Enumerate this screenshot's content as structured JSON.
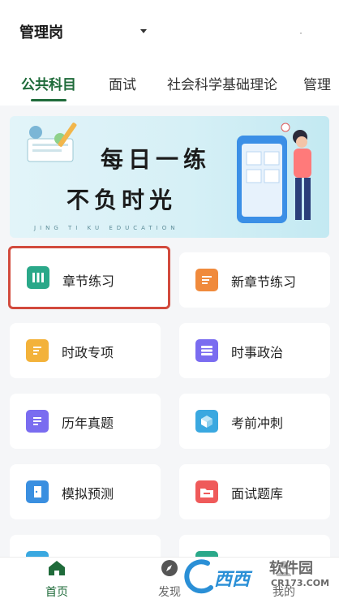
{
  "header": {
    "selector_label": "管理岗"
  },
  "tabs": [
    {
      "label": "公共科目",
      "active": true
    },
    {
      "label": "面试",
      "active": false
    },
    {
      "label": "社会科学基础理论",
      "active": false
    },
    {
      "label": "管理",
      "active": false
    }
  ],
  "banner": {
    "line1": "每日一练",
    "line2": "不负时光",
    "sub": "JING TI KU EDUCATION"
  },
  "grid": [
    {
      "label": "章节练习",
      "icon": "chapter-practice-icon",
      "color": "#2aa889"
    },
    {
      "label": "新章节练习",
      "icon": "new-chapter-icon",
      "color": "#f08a3c"
    },
    {
      "label": "时政专项",
      "icon": "current-affairs-icon",
      "color": "#f3b23a"
    },
    {
      "label": "时事政治",
      "icon": "list-icon",
      "color": "#7a6cf0"
    },
    {
      "label": "历年真题",
      "icon": "past-exams-icon",
      "color": "#7a6cf0"
    },
    {
      "label": "考前冲刺",
      "icon": "cube-icon",
      "color": "#3aa8e0"
    },
    {
      "label": "模拟预测",
      "icon": "door-icon",
      "color": "#3a8fe0"
    },
    {
      "label": "面试题库",
      "icon": "folder-icon",
      "color": "#ef5a5a"
    }
  ],
  "bottom_nav": [
    {
      "label": "首页",
      "icon": "home-icon",
      "active": true
    },
    {
      "label": "发现",
      "icon": "compass-icon",
      "active": false
    },
    {
      "label": "我的",
      "icon": "user-icon",
      "active": false
    }
  ],
  "watermark": {
    "brand": "西西",
    "text": "软件园",
    "site": "CR173.COM"
  },
  "colors": {
    "accent": "#1f6b3a",
    "selected_border": "#d24a3d"
  }
}
